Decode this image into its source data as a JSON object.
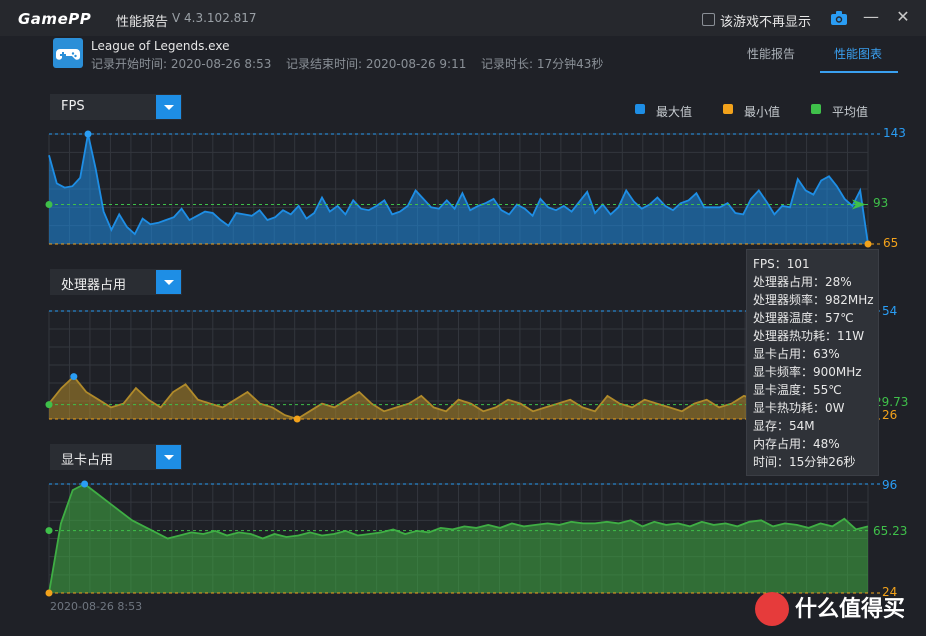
{
  "window": {
    "logo": "GamePP",
    "title": "性能报告",
    "version": "V 4.3.102.817",
    "checkbox_label": "该游戏不再显示",
    "minimize_label": "—",
    "close_label": "✕"
  },
  "info": {
    "game_name": "League of Legends.exe",
    "start_time": "记录开始时间: 2020-08-26 8:53",
    "end_time": "记录结束时间: 2020-08-26 9:11",
    "duration": "记录时长: 17分钟43秒"
  },
  "tabs": [
    {
      "label": "性能报告",
      "active": false
    },
    {
      "label": "性能图表",
      "active": true
    }
  ],
  "legend": [
    {
      "label": "最大值",
      "color": "#1e8ee5"
    },
    {
      "label": "最小值",
      "color": "#f2a21b"
    },
    {
      "label": "平均值",
      "color": "#3fc04a"
    }
  ],
  "colors": {
    "accent": "#1e8ee5",
    "max": "#2a9df4",
    "min": "#f2a21b",
    "avg": "#3fc04a"
  },
  "chart_data": [
    {
      "type": "area",
      "selector_label": "FPS",
      "max": "143",
      "avg": "93",
      "min": "65",
      "ylim": [
        65,
        143
      ],
      "color": "#1e8ee5",
      "values": [
        128,
        108,
        105,
        106,
        112,
        143,
        118,
        88,
        75,
        86,
        77,
        72,
        83,
        79,
        80,
        82,
        84,
        90,
        82,
        85,
        88,
        87,
        82,
        78,
        87,
        86,
        85,
        89,
        82,
        84,
        89,
        86,
        92,
        83,
        87,
        98,
        88,
        92,
        86,
        96,
        90,
        89,
        92,
        96,
        86,
        88,
        92,
        103,
        97,
        91,
        90,
        96,
        90,
        101,
        89,
        92,
        94,
        97,
        89,
        86,
        93,
        90,
        85,
        97,
        91,
        89,
        92,
        88,
        95,
        102,
        87,
        93,
        86,
        91,
        103,
        95,
        90,
        93,
        98,
        92,
        89,
        94,
        96,
        101,
        91,
        91,
        91,
        94,
        87,
        86,
        97,
        103,
        95,
        86,
        92,
        91,
        111,
        103,
        100,
        110,
        113,
        106,
        97,
        92,
        103,
        65
      ]
    },
    {
      "type": "area",
      "selector_label": "处理器占用",
      "max": "54",
      "avg": "29.73",
      "min": "26",
      "ylim": [
        26,
        54
      ],
      "color": "#b08a2a",
      "values": [
        30,
        34,
        37,
        33,
        31,
        29,
        30,
        34,
        31,
        29,
        33,
        35,
        31,
        30,
        29,
        31,
        33,
        30,
        29,
        27,
        26,
        28,
        30,
        29,
        31,
        33,
        30,
        28,
        29,
        30,
        32,
        29,
        28,
        31,
        30,
        28,
        29,
        31,
        30,
        28,
        29,
        30,
        31,
        29,
        28,
        32,
        30,
        29,
        31,
        30,
        29,
        28,
        30,
        31,
        29,
        30,
        32,
        31,
        30,
        29,
        28,
        30,
        36,
        31,
        30,
        29,
        31
      ]
    },
    {
      "type": "area",
      "selector_label": "显卡占用",
      "max": "96",
      "avg": "65.23",
      "min": "24",
      "ylim": [
        24,
        96
      ],
      "color": "#3fae44",
      "values": [
        24,
        70,
        92,
        96,
        90,
        84,
        78,
        72,
        68,
        64,
        60,
        62,
        64,
        63,
        65,
        62,
        64,
        63,
        60,
        63,
        61,
        62,
        64,
        62,
        63,
        65,
        62,
        63,
        64,
        66,
        63,
        65,
        64,
        67,
        66,
        68,
        67,
        69,
        67,
        70,
        68,
        69,
        70,
        69,
        71,
        70,
        70,
        71,
        70,
        72,
        68,
        71,
        69,
        70,
        68,
        71,
        69,
        70,
        68,
        71,
        72,
        68,
        70,
        69,
        67,
        70,
        68,
        73,
        66,
        68
      ]
    }
  ],
  "tooltip": [
    "FPS：101",
    "处理器占用：28%",
    "处理器频率：982MHz",
    "处理器温度：57℃",
    "处理器热功耗：11W",
    "显卡占用：63%",
    "显卡频率：900MHz",
    "显卡温度：55℃",
    "显卡热功耗：0W",
    "显存：54M",
    "内存占用：48%",
    "时间：15分钟26秒"
  ],
  "footer": {
    "start_date": "2020-08-26 8:53"
  },
  "watermark": {
    "text": "什么值得买",
    "icon": "值-logo"
  }
}
